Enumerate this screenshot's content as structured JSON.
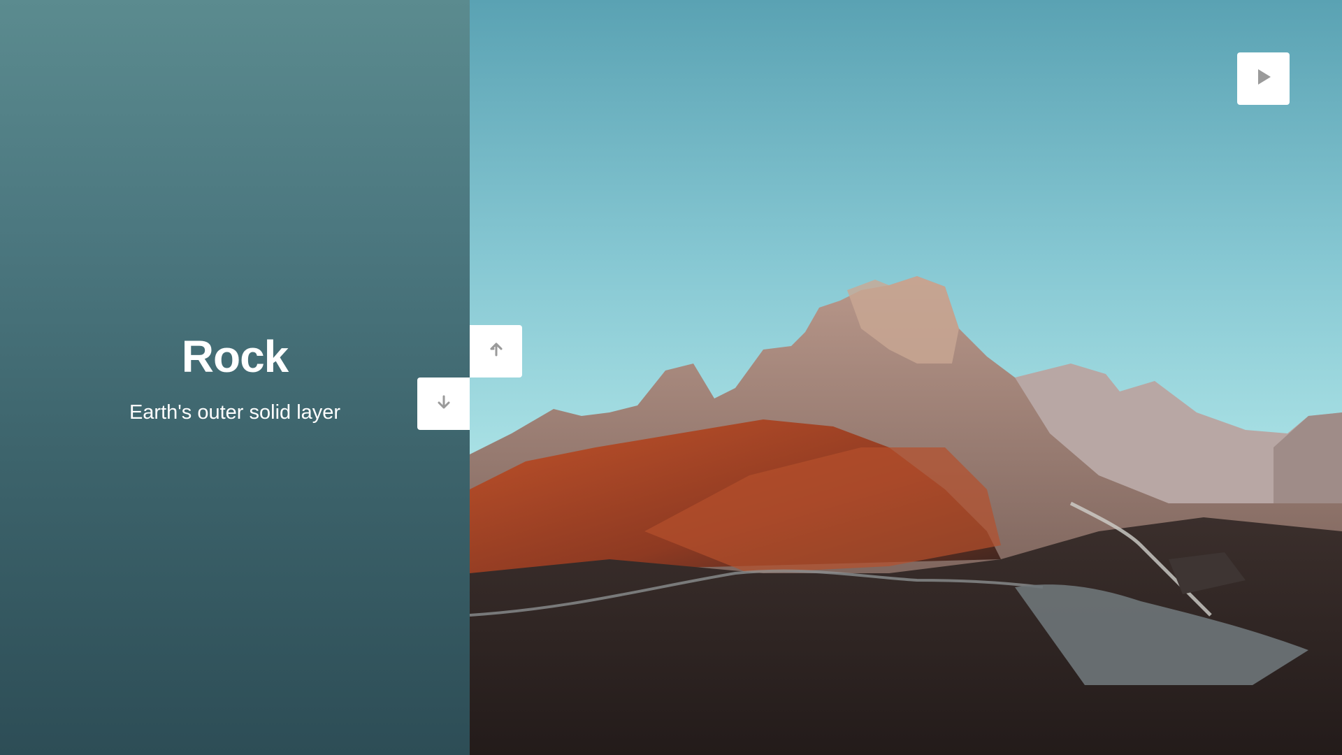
{
  "slide": {
    "title": "Rock",
    "subtitle": "Earth's outer solid layer"
  },
  "controls": {
    "up_icon": "arrow-up-icon",
    "down_icon": "arrow-down-icon",
    "play_icon": "play-icon"
  },
  "colors": {
    "panel_top": "#5b8b8f",
    "panel_bottom": "#2d4d56",
    "text": "#ffffff",
    "button_bg": "#ffffff",
    "icon": "#9a9a9a"
  }
}
